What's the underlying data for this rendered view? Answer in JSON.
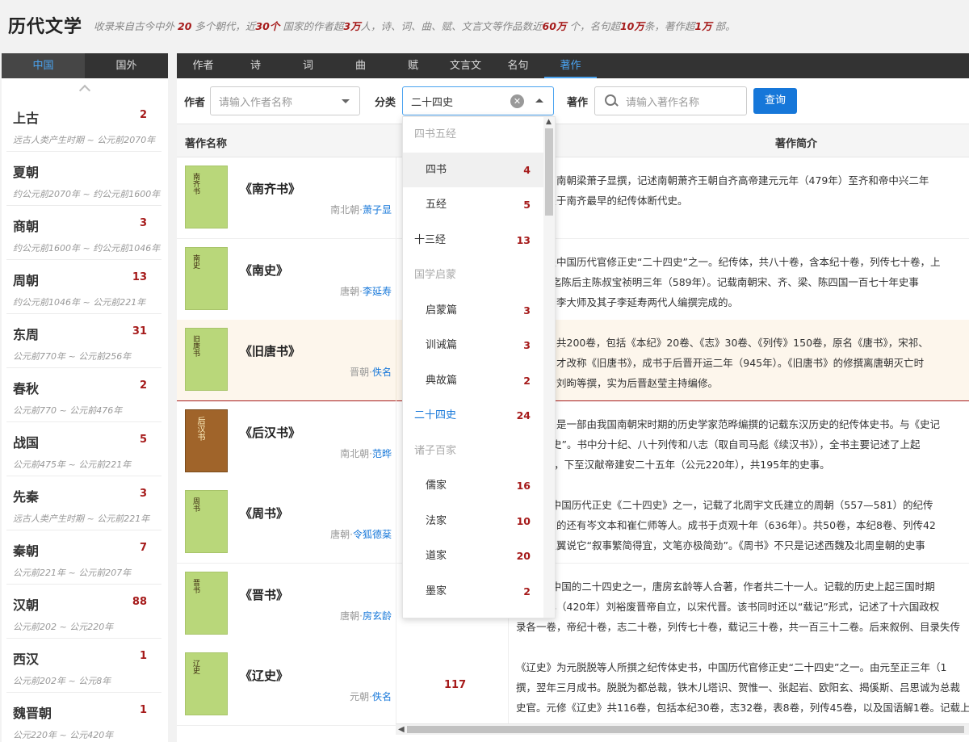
{
  "header": {
    "title": "历代文学",
    "stats": {
      "p1": "收录来自古今中外",
      "n1": "20",
      "p2": "多个朝代，近",
      "n2": "30个",
      "p3": "国家的作者超",
      "n3": "3万",
      "p4": "人，诗、词、曲、赋、文言文等作品数近",
      "n4": "60万",
      "p5": "个，名句超",
      "n5": "10万",
      "p6": "条，著作超",
      "n6": "1万",
      "p7": "部。"
    }
  },
  "left": {
    "tabs": [
      "中国",
      "国外"
    ],
    "dynasties": [
      {
        "name": "上古",
        "count": "2",
        "range": "远古人类产生时期 ~ 公元前2070年"
      },
      {
        "name": "夏朝",
        "count": "",
        "range": "约公元前2070年 ~ 约公元前1600年"
      },
      {
        "name": "商朝",
        "count": "3",
        "range": "约公元前1600年 ~ 约公元前1046年"
      },
      {
        "name": "周朝",
        "count": "13",
        "range": "约公元前1046年 ~ 公元前221年"
      },
      {
        "name": "东周",
        "count": "31",
        "range": "公元前770年 ~ 公元前256年"
      },
      {
        "name": "春秋",
        "count": "2",
        "range": "公元前770 ~ 公元前476年"
      },
      {
        "name": "战国",
        "count": "5",
        "range": "公元前475年 ~ 公元前221年"
      },
      {
        "name": "先秦",
        "count": "3",
        "range": "远古人类产生时期 ~ 公元前221年"
      },
      {
        "name": "秦朝",
        "count": "7",
        "range": "公元前221年 ~ 公元前207年"
      },
      {
        "name": "汉朝",
        "count": "88",
        "range": "公元前202 ~ 公元220年"
      },
      {
        "name": "西汉",
        "count": "1",
        "range": "公元前202年 ~ 公元8年"
      },
      {
        "name": "魏晋朝",
        "count": "1",
        "range": "公元220年 ~ 公元420年"
      }
    ]
  },
  "tabs": [
    "作者",
    "诗",
    "词",
    "曲",
    "赋",
    "文言文",
    "名句",
    "著作"
  ],
  "filters": {
    "author_label": "作者",
    "author_placeholder": "请输入作者名称",
    "category_label": "分类",
    "category_value": "二十四史",
    "clear_glyph": "✕",
    "work_label": "著作",
    "work_placeholder": "请输入著作名称",
    "query_button": "查询"
  },
  "table": {
    "col_name": "著作名称",
    "col_desc": "著作简介",
    "rows": [
      {
        "cover": "南齐书",
        "title": "《南齐书》",
        "dynasty": "南北朝·",
        "author": "萧子显",
        "count": "",
        "desc1": "齐书》），南朝梁萧子显撰，记述南朝萧齐王朝自齐高帝建元元年（479年）至齐和帝中兴二年",
        "desc2": "是现存关于南齐最早的纪传体断代史。",
        "desc3": ""
      },
      {
        "cover": "南史",
        "title": "《南史》",
        "dynasty": "唐朝·",
        "author": "李延寿",
        "count": "",
        "desc1": "南史》是中国历代官修正史“二十四史”之一。纪传体，共八十卷，含本纪十卷，列传七十卷，上",
        "desc2": "年），下迄陈后主陈叔宝祯明三年（589年）。记载南朝宋、齐、梁、陈四国一百七十年史事",
        "desc3": "寿，是由李大师及其子李延寿两代人编撰完成的。"
      },
      {
        "cover": "旧唐书",
        "title": "《旧唐书》",
        "dynasty": "晋朝·",
        "author": "佚名",
        "count": "",
        "desc1": "旧唐书》共200卷，包括《本纪》20卷、《志》30卷、《列传》150卷，原名《唐书》，宋祁、",
        "desc2": "问世后，才改称《旧唐书》，成书于后晋开运二年（945年）。《旧唐书》的修撰离唐朝灭亡时",
        "desc3": "署名后晋刘昫等撰，实为后晋赵莹主持编修。"
      },
      {
        "cover": "后汉书",
        "title": "《后汉书》",
        "dynasty": "南北朝·",
        "author": "范晔",
        "count": "",
        "desc1": "后汉书》是一部由我国南朝宋时期的历史学家范晔编撰的记载东汉历史的纪传体史书。与《史记",
        "desc2": "称“前四史”。书中分十纪、八十列传和八志（取自司马彪《续汉书》），全书主要记述了上起",
        "desc3": "元25年），下至汉献帝建安二十五年（公元220年），共195年的史事。"
      },
      {
        "cover": "周书",
        "title": "《周书》",
        "dynasty": "唐朝·",
        "author": "令狐德棻",
        "count": "",
        "desc1": "周书》，中国历代正史《二十四史》之一，记载了北周宇文氏建立的周朝（557—581）的纪传",
        "desc2": "参加编写的还有岑文本和崔仁师等人。成书于贞观十年（636年）。共50卷，本纪8卷、列传42",
        "desc3": "代史家赵翼说它“叙事繁简得宜，文笔亦极简劲”。《周书》不只是记述西魏及北周皇朝的史事"
      },
      {
        "cover": "晋书",
        "title": "《晋书》",
        "dynasty": "唐朝·",
        "author": "房玄龄",
        "count": "",
        "desc1": "晋书》，中国的二十四史之一，唐房玄龄等人合著，作者共二十一人。记载的历史上起三国时期",
        "desc2": "元熙二年（420年）刘裕废晋帝自立，以宋代晋。该书同时还以“载记”形式，记述了十六国政权",
        "desc3": "录各一卷，帝纪十卷，志二十卷，列传七十卷，载记三十卷，共一百三十二卷。后来叙例、目录失传"
      },
      {
        "cover": "辽史",
        "title": "《辽史》",
        "dynasty": "元朝·",
        "author": "佚名",
        "count": "117",
        "desc1": "《辽史》为元脱脱等人所撰之纪传体史书，中国历代官修正史“二十四史”之一。由元至正三年（1",
        "desc2": "撰，翌年三月成书。脱脱为都总裁，铁木儿塔识、贺惟一、张起岩、欧阳玄、揭傒斯、吕思诚为总裁",
        "desc3": "史官。元修《辽史》共116卷，包括本纪30卷，志32卷，表8卷，列传45卷，以及国语解1卷。记载上"
      }
    ]
  },
  "dropdown": {
    "items": [
      {
        "label": "四书五经",
        "type": "group",
        "count": ""
      },
      {
        "label": "四书",
        "type": "sub",
        "count": "4"
      },
      {
        "label": "五经",
        "type": "sub",
        "count": "5"
      },
      {
        "label": "十三经",
        "type": "top",
        "count": "13"
      },
      {
        "label": "国学启蒙",
        "type": "group",
        "count": ""
      },
      {
        "label": "启蒙篇",
        "type": "sub",
        "count": "3"
      },
      {
        "label": "训诫篇",
        "type": "sub",
        "count": "3"
      },
      {
        "label": "典故篇",
        "type": "sub",
        "count": "2"
      },
      {
        "label": "二十四史",
        "type": "top",
        "count": "24"
      },
      {
        "label": "诸子百家",
        "type": "group",
        "count": ""
      },
      {
        "label": "儒家",
        "type": "sub",
        "count": "16"
      },
      {
        "label": "法家",
        "type": "sub",
        "count": "10"
      },
      {
        "label": "道家",
        "type": "sub",
        "count": "20"
      },
      {
        "label": "墨家",
        "type": "sub",
        "count": "2"
      }
    ],
    "selected": "二十四史",
    "hovered": "四书"
  },
  "icons": {
    "scroll_up": "▲",
    "scroll_left": "◀"
  },
  "colors": {
    "accent": "#1677d9",
    "count_red": "#a61b1b",
    "tab_bar": "#333333",
    "cover_green": "#b9d77a"
  }
}
